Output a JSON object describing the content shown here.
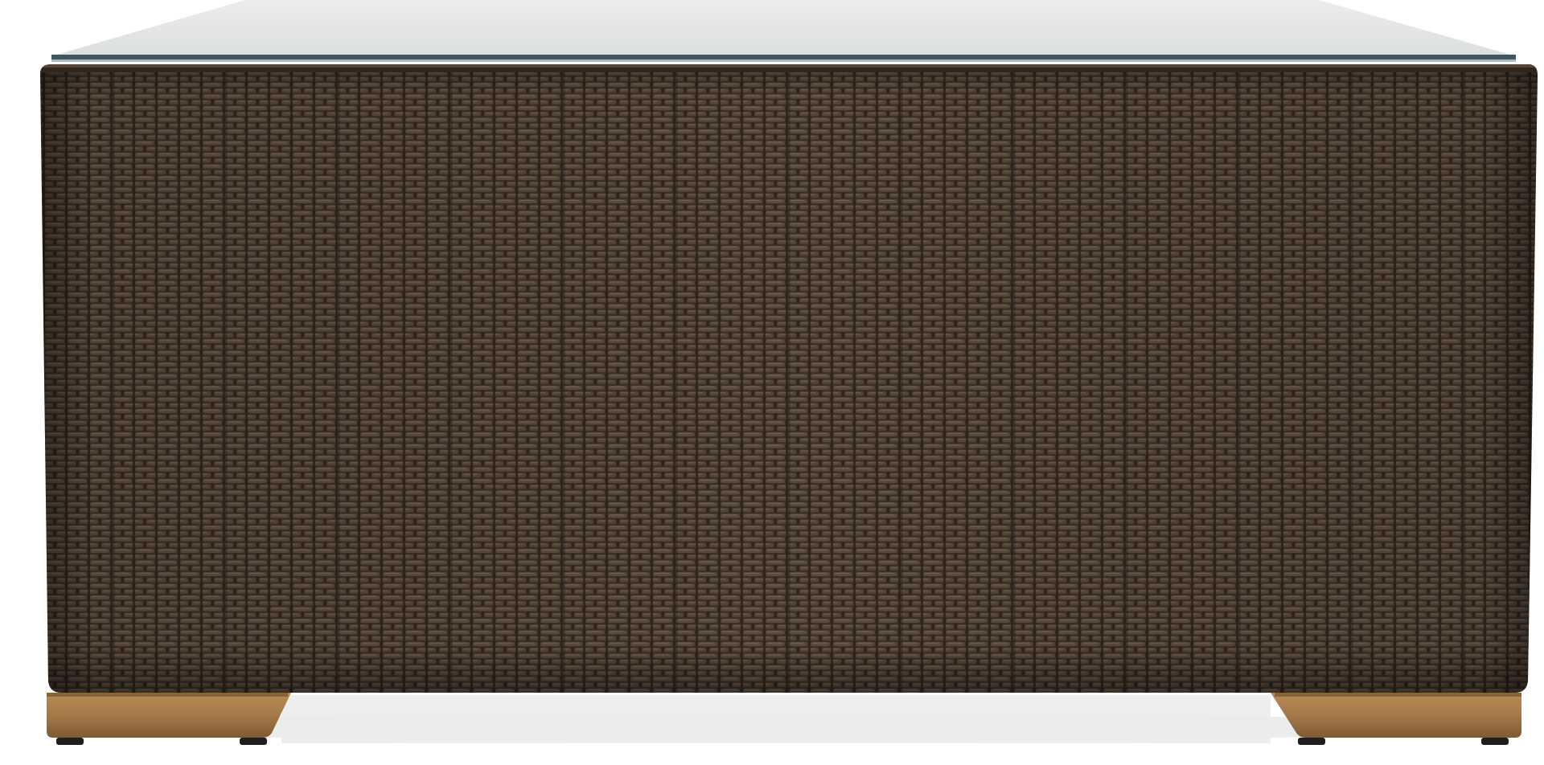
{
  "product": {
    "kind": "wicker coffee table, front view",
    "colors": {
      "background": "#ffffff",
      "wicker_base": "#3b3128",
      "wicker_strand": "#5a4a3c",
      "wicker_highlight": "#7a6654",
      "wicker_shadow": "#241c16",
      "glass_top": "#e3e5e6",
      "glass_edge": "#3f5560",
      "teak_foot": "#a47a4a",
      "teak_foot_dark": "#7d5a33",
      "foot_pad": "#1e1e1e",
      "floor_shadow": "#e9e9e9"
    }
  }
}
